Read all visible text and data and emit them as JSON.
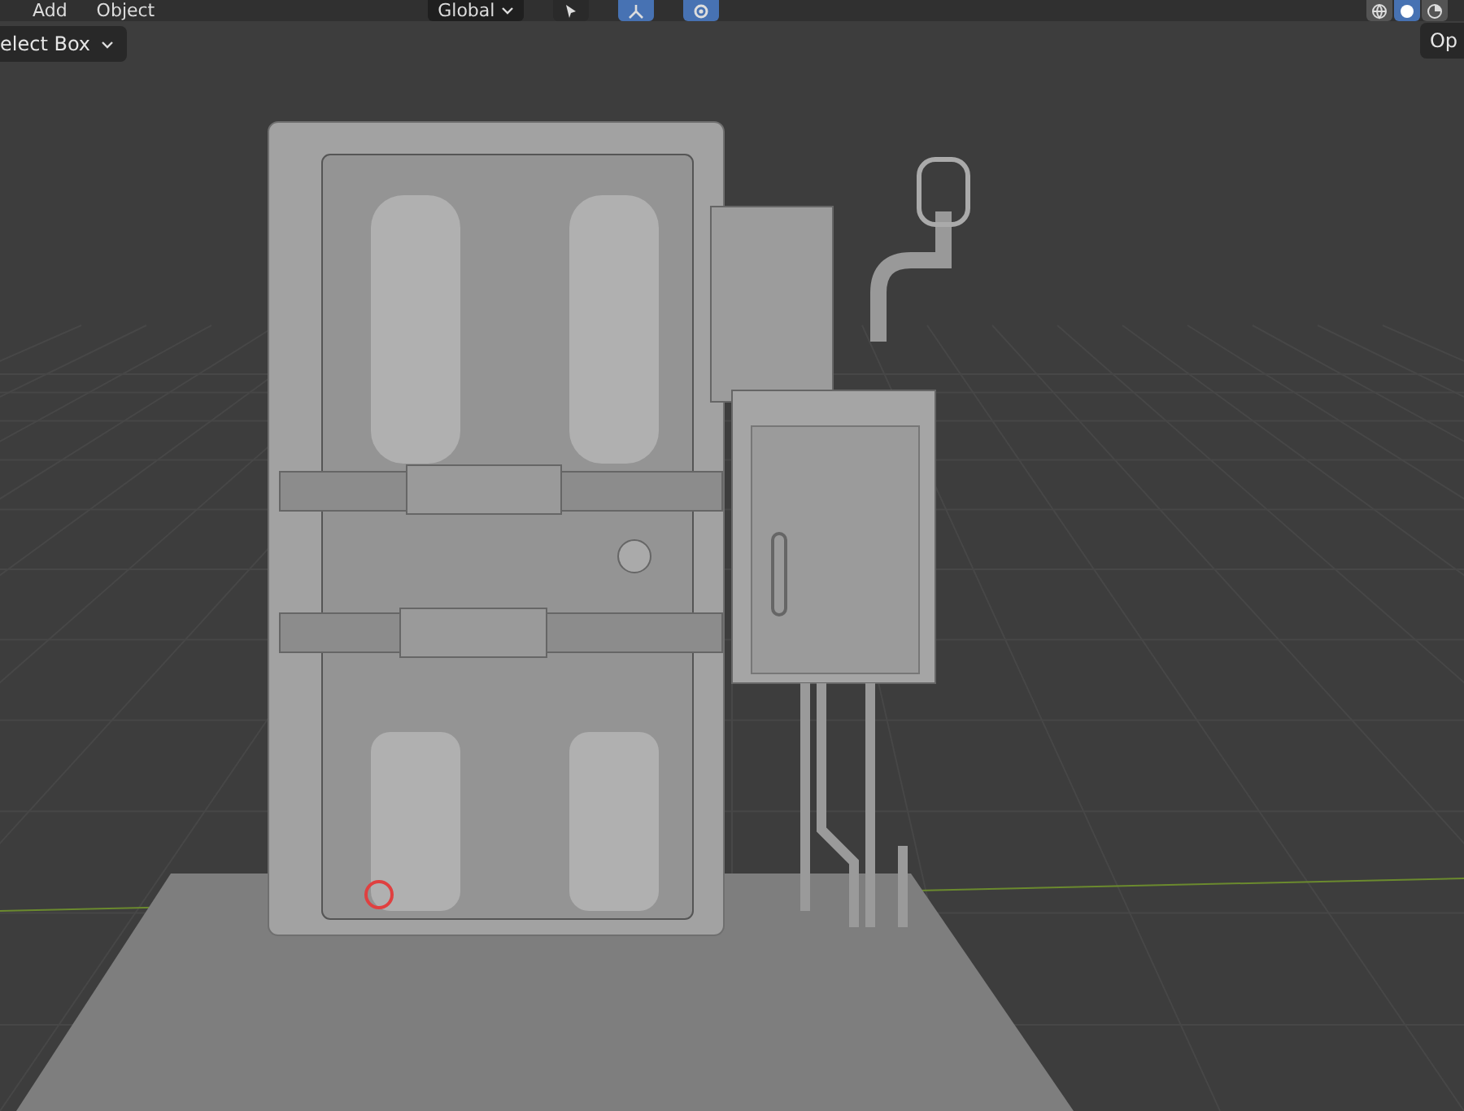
{
  "header": {
    "menus": [
      {
        "label": "Add"
      },
      {
        "label": "Object"
      }
    ],
    "orientation": "Global",
    "toggles": [
      {
        "kind": "select",
        "on": false
      },
      {
        "kind": "gizmo",
        "on": true
      },
      {
        "kind": "overlay",
        "on": true
      }
    ],
    "shading": [
      {
        "kind": "wire",
        "selected": false
      },
      {
        "kind": "solid",
        "selected": true
      },
      {
        "kind": "material",
        "selected": false
      }
    ]
  },
  "tool": {
    "label": "elect Box"
  },
  "options": {
    "label": "Op"
  }
}
